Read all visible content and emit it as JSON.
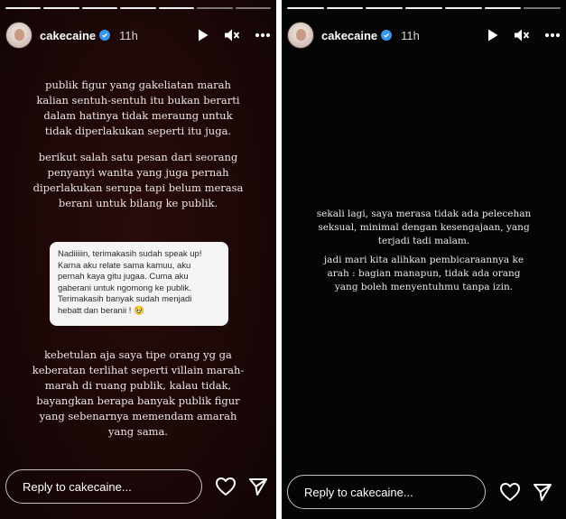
{
  "left": {
    "username": "cakecaine",
    "time": "11h",
    "paragraph1": "publik figur yang gakeliatan marah\nkalian sentuh-sentuh itu bukan berarti\ndalam hatinya tidak meraung untuk\ntidak diperlakukan seperti itu juga.",
    "paragraph2": "berikut salah satu pesan dari seorang\npenyanyi wanita yang juga pernah\ndiperlakukan serupa tapi belum merasa\nberani untuk bilang ke publik.",
    "quoted_message": "Nadiiiiin, terimakasih sudah speak up!\nKarna aku relate sama kamuu, aku\npernah kaya gitu jugaa. Cuma aku\ngaberani untuk ngomong ke publik.\nTerimakasih banyak sudah menjadi\nhebatt dan beranii ! 🥹",
    "paragraph3": "kebetulan aja saya tipe orang yg ga\nkeberatan terlihat seperti villain marah-\nmarah di ruang publik, kalau tidak,\nbayangkan berapa banyak publik figur\nyang sebenarnya memendam amarah\nyang sama.",
    "reply_placeholder": "Reply to cakecaine..."
  },
  "right": {
    "username": "cakecaine",
    "time": "11h",
    "paragraph1": "sekali lagi, saya merasa tidak ada pelecehan\nseksual, minimal dengan kesengajaan, yang\nterjadi tadi malam.",
    "paragraph2": "jadi mari kita alihkan pembicaraannya ke\narah : bagian manapun, tidak ada orang\nyang boleh menyentuhmu tanpa izin.",
    "reply_placeholder": "Reply to cakecaine..."
  },
  "icons": {
    "play": "play-icon",
    "mute": "mute-icon",
    "more": "more-icon",
    "verified": "verified-badge-icon",
    "like": "heart-icon",
    "send": "send-icon"
  },
  "colors": {
    "verified": "#3797f0",
    "left_background": "#1f0808",
    "right_background": "#050505"
  }
}
